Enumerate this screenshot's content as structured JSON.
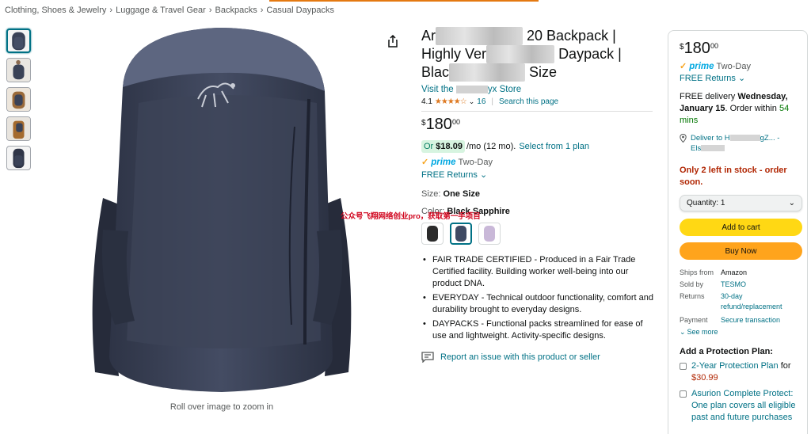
{
  "breadcrumb": {
    "items": [
      "Clothing, Shoes & Jewelry",
      "Luggage & Travel Gear",
      "Backpacks",
      "Casual Daypacks"
    ],
    "separator": "›"
  },
  "gallery": {
    "thumbnails": [
      "navy-backpack-front",
      "backpack-worn-back",
      "brown-backpack-worn",
      "brown-jacket-model",
      "navy-backpack-side"
    ],
    "active_index": 0,
    "zoom_caption": "Roll over image to zoom in"
  },
  "product": {
    "title_line1_a": "Ar",
    "title_line1_b": "20 Backpack |",
    "title_line2_a": "Highly Ver",
    "title_line2_b": "Daypack |",
    "title_line3_a": "Blac",
    "title_line3_b": "Size",
    "store_prefix": "Visit the",
    "store_suffix": "yx Store",
    "rating": "4.1",
    "stars": "★★★★☆",
    "review_count": "16",
    "search_link": "Search this page",
    "price_currency": "$",
    "price_whole": "180",
    "price_fraction": "00",
    "monthly_prefix": "Or",
    "monthly_amount": "$18.09",
    "monthly_suffix": "/mo (12 mo).",
    "monthly_link": "Select from 1 plan",
    "prime_label": "Two-Day",
    "returns_label": "FREE Returns",
    "size_label": "Size:",
    "size_value": "One Size",
    "color_label": "Color:",
    "color_value": "Black Sapphire",
    "watermark": "公众号飞翔网络创业pro，获取第一手项目",
    "swatch_colors": [
      "#2b2b2b",
      "#3f4a63",
      "#c9b8d8"
    ],
    "active_swatch": 1,
    "bullets": [
      "FAIR TRADE CERTIFIED - Produced in a Fair Trade Certified facility. Building worker well-being into our product DNA.",
      "EVERYDAY - Technical outdoor functionality, comfort and durability brought to everyday designs.",
      "DAYPACKS - Functional packs streamlined for ease of use and lightweight. Activity-specific designs."
    ],
    "report_link": "Report an issue with this product or seller"
  },
  "buybox": {
    "price_currency": "$",
    "price_whole": "180",
    "price_fraction": "00",
    "prime_label": "Two-Day",
    "returns_label": "FREE Returns",
    "delivery_prefix": "FREE delivery",
    "delivery_date": "Wednesday, January 15",
    "delivery_order_within": ". Order within",
    "delivery_countdown": "54 mins",
    "deliver_to_prefix": "Deliver to H",
    "deliver_to_mid": "gZ... -",
    "deliver_to_line2": "Els",
    "stock_message": "Only 2 left in stock - order soon.",
    "quantity_label": "Quantity:",
    "quantity_value": "1",
    "add_to_cart": "Add to cart",
    "buy_now": "Buy Now",
    "details": [
      {
        "key": "Ships from",
        "value": "Amazon"
      },
      {
        "key": "Sold by",
        "value": "TESMO"
      },
      {
        "key": "Returns",
        "value": "30-day refund/replacement"
      },
      {
        "key": "Payment",
        "value": "Secure transaction"
      }
    ],
    "see_more": "See more",
    "protection_title": "Add a Protection Plan:",
    "plan1_link": "2-Year Protection Plan",
    "plan1_for": "for",
    "plan1_price": "$30.99",
    "plan2_text": "Asurion Complete Protect: One plan covers all eligible past and future purchases"
  },
  "colors": {
    "link": "#007185",
    "price_red": "#b12704",
    "prime_blue": "#00a8e1",
    "cart_yellow": "#ffd814",
    "buy_orange": "#ffa41c",
    "backpack_navy": "#3a4257"
  }
}
